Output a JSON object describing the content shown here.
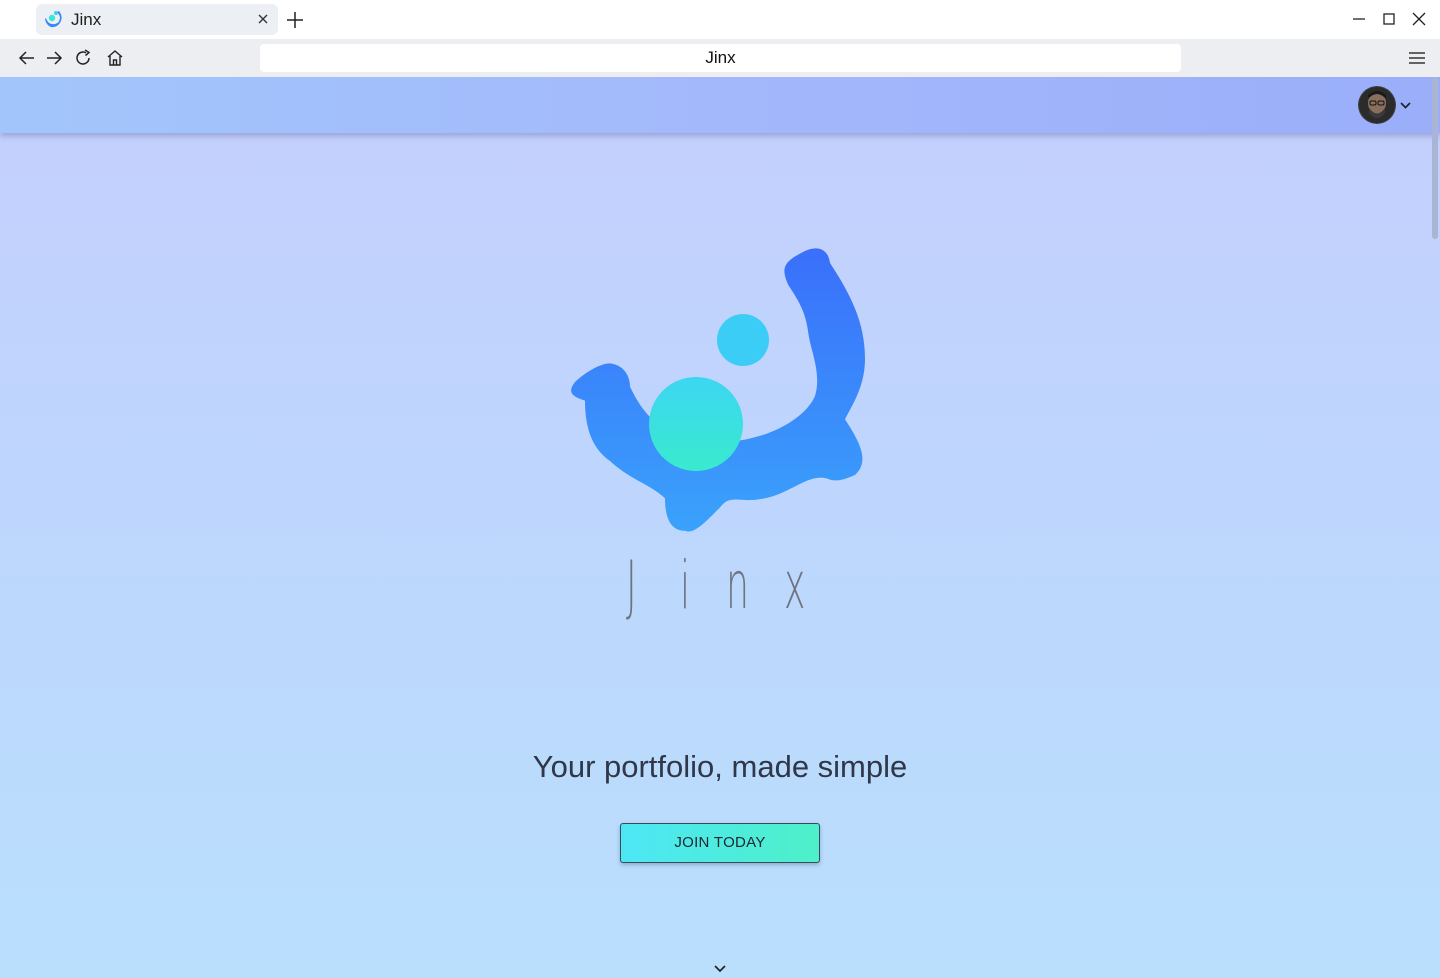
{
  "browser": {
    "tab_title": "Jinx",
    "url_text": "Jinx",
    "icons": {
      "favicon": "jinx-logo-icon",
      "tab_close": "close-icon",
      "new_tab": "plus-icon",
      "minimize": "minimize-icon",
      "maximize": "maximize-icon",
      "window_close": "close-icon",
      "back": "arrow-left-icon",
      "forward": "arrow-right-icon",
      "reload": "reload-icon",
      "home": "home-icon",
      "menu": "hamburger-menu-icon"
    }
  },
  "header": {
    "avatar_icon": "user-avatar",
    "avatar_menu_icon": "chevron-down-icon"
  },
  "hero": {
    "wordmark_letters": [
      "J",
      "i",
      "n",
      "x"
    ],
    "tagline": "Your portfolio, made simple",
    "cta_label": "JOIN TODAY",
    "scroll_icon": "chevron-down-icon"
  },
  "colors": {
    "header_gradient": [
      "#a2c6fb",
      "#9aaefa"
    ],
    "page_gradient": [
      "#c4cffd",
      "#badffd"
    ],
    "logo_gear": [
      "#3a6ffb",
      "#3a9ffb"
    ],
    "logo_dot_small": "#3ccdf7",
    "logo_dot_large": "#3ae6d6",
    "cta_gradient": [
      "#4de7f5",
      "#4df0c8"
    ]
  }
}
